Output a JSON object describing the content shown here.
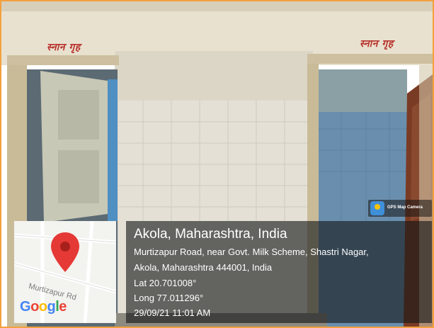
{
  "photo": {
    "sign_left": "स्नान गृह",
    "sign_right": "स्नान गृह"
  },
  "gps_badge": {
    "label": "GPS Map Camera"
  },
  "map": {
    "road_label": "Murtizapur Rd",
    "logo_text": "Google"
  },
  "location": {
    "title": "Akola, Maharashtra, India",
    "address_line1": "Murtizapur Road, near Govt. Milk Scheme, Shastri Nagar,",
    "address_line2": "Akola, Maharashtra 444001, India",
    "lat": "Lat 20.701008°",
    "long": "Long 77.011296°",
    "timestamp": "29/09/21 11:01 AM"
  },
  "colors": {
    "frame_border": "#f2a03d",
    "sign_text": "#b8322c",
    "map_pin": "#e53935",
    "overlay": "rgba(20,22,24,0.62)"
  }
}
